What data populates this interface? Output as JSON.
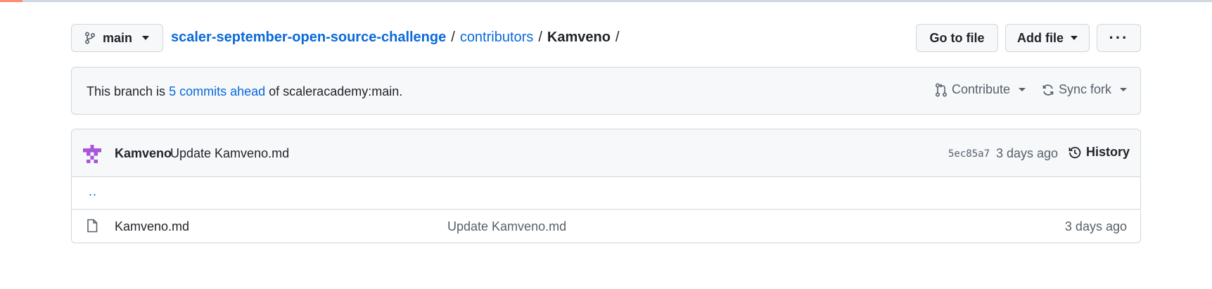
{
  "branch": {
    "name": "main"
  },
  "breadcrumb": {
    "repo": "scaler-september-open-source-challenge",
    "folder": "contributors",
    "current": "Kamveno",
    "separator": "/"
  },
  "actions": {
    "go_to_file": "Go to file",
    "add_file": "Add file",
    "more": "···"
  },
  "status": {
    "prefix": "This branch is",
    "ahead_link": "5 commits ahead",
    "suffix": "of scaleracademy:main.",
    "contribute": "Contribute",
    "sync_fork": "Sync fork"
  },
  "commit": {
    "author": "Kamveno",
    "message": "Update Kamveno.md",
    "sha": "5ec85a7",
    "time": "3 days ago",
    "history": "History"
  },
  "parent_dir": "..",
  "files": [
    {
      "name": "Kamveno.md",
      "commit_message": "Update Kamveno.md",
      "time": "3 days ago"
    }
  ],
  "colors": {
    "link": "#0969da",
    "accent_loader": "#fd8c73",
    "avatar": "#a855d8"
  },
  "icons": [
    "git-branch-icon",
    "git-pull-request-icon",
    "sync-icon",
    "history-icon",
    "file-icon"
  ]
}
